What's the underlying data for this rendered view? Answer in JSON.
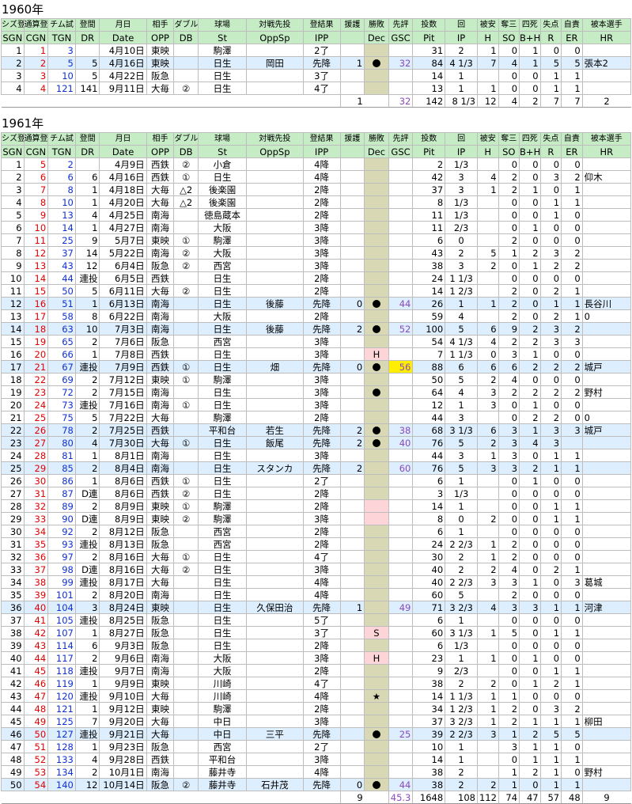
{
  "headers1": [
    "シズ登",
    "通算登",
    "チム試",
    "登間",
    "月日",
    "相手",
    "ダブル",
    "球場",
    "対戦先投",
    "登結果",
    "援護",
    "勝敗",
    "先評",
    "投数",
    "回",
    "被安",
    "奪三",
    "四死",
    "失点",
    "自責",
    "被本選手"
  ],
  "headers2": [
    "SGN",
    "CGN",
    "TGN",
    "DR",
    "Date",
    "OPP",
    "DB",
    "St",
    "OppSp",
    "IPP",
    "",
    "Dec",
    "GSC",
    "Pit",
    "IP",
    "H",
    "SO",
    "B+H",
    "R",
    "ER",
    "HR"
  ],
  "years": [
    {
      "title": "1960年",
      "rows": [
        [
          "1",
          "1",
          "3",
          "",
          "4月10日",
          "東映",
          "",
          "駒澤",
          "",
          "2了",
          "",
          "",
          "",
          "31",
          "2",
          "1",
          "0",
          "1",
          "0",
          "0",
          ""
        ],
        [
          "2",
          "2",
          "5",
          "5",
          "4月16日",
          "東映",
          "",
          "日生",
          "岡田",
          "先降",
          "1",
          "●",
          "32",
          "84",
          "4 1/3",
          "7",
          "4",
          "1",
          "5",
          "5",
          "張本2"
        ],
        [
          "3",
          "3",
          "10",
          "5",
          "4月22日",
          "阪急",
          "",
          "日生",
          "",
          "3了",
          "",
          "",
          "",
          "14",
          "1",
          "",
          "0",
          "0",
          "1",
          "1",
          ""
        ],
        [
          "4",
          "4",
          "121",
          "141",
          "9月11日",
          "大毎",
          "②",
          "日生",
          "",
          "4了",
          "",
          "",
          "",
          "13",
          "1",
          "1",
          "0",
          "0",
          "1",
          "1",
          ""
        ]
      ],
      "hl": [
        1
      ],
      "total": {
        "support": "1",
        "gsc": "32",
        "pit": "142",
        "ip": "8 1/3",
        "h": "12",
        "so": "4",
        "bh": "2",
        "r": "7",
        "er": "7",
        "hr": "2"
      }
    },
    {
      "title": "1961年",
      "rows": [
        [
          "1",
          "5",
          "2",
          "",
          "4月9日",
          "西鉄",
          "②",
          "小倉",
          "",
          "4降",
          "",
          "",
          "",
          "2",
          "1/3",
          "",
          "0",
          "0",
          "0",
          "0",
          ""
        ],
        [
          "2",
          "6",
          "6",
          "6",
          "4月16日",
          "西鉄",
          "①",
          "日生",
          "",
          "4降",
          "",
          "",
          "",
          "42",
          "3",
          "4",
          "2",
          "0",
          "3",
          "2",
          "仰木"
        ],
        [
          "3",
          "7",
          "8",
          "1",
          "4月18日",
          "大毎",
          "△2",
          "後楽園",
          "",
          "2降",
          "",
          "",
          "",
          "37",
          "3",
          "1",
          "2",
          "1",
          "0",
          "1",
          ""
        ],
        [
          "4",
          "8",
          "10",
          "1",
          "4月20日",
          "大毎",
          "△2",
          "後楽園",
          "",
          "2降",
          "",
          "",
          "",
          "8",
          "1/3",
          "",
          "0",
          "0",
          "1",
          "1",
          ""
        ],
        [
          "5",
          "9",
          "13",
          "4",
          "4月25日",
          "南海",
          "",
          "徳島蔵本",
          "",
          "2降",
          "",
          "",
          "",
          "11",
          "1/3",
          "",
          "0",
          "0",
          "1",
          "0",
          ""
        ],
        [
          "6",
          "10",
          "14",
          "1",
          "4月27日",
          "南海",
          "",
          "大阪",
          "",
          "3降",
          "",
          "",
          "",
          "11",
          "2/3",
          "",
          "0",
          "1",
          "0",
          "0",
          ""
        ],
        [
          "7",
          "11",
          "25",
          "9",
          "5月7日",
          "東映",
          "①",
          "駒澤",
          "",
          "3降",
          "",
          "",
          "",
          "6",
          "0",
          "",
          "2",
          "0",
          "0",
          "0",
          ""
        ],
        [
          "8",
          "12",
          "37",
          "14",
          "5月22日",
          "南海",
          "②",
          "大阪",
          "",
          "3降",
          "",
          "",
          "",
          "43",
          "2",
          "5",
          "1",
          "2",
          "3",
          "2",
          ""
        ],
        [
          "9",
          "13",
          "43",
          "12",
          "6月4日",
          "阪急",
          "②",
          "西宮",
          "",
          "3降",
          "",
          "",
          "",
          "38",
          "3",
          "2",
          "0",
          "1",
          "2",
          "2",
          ""
        ],
        [
          "10",
          "14",
          "44",
          "連投",
          "6月5日",
          "西鉄",
          "",
          "日生",
          "",
          "2降",
          "",
          "",
          "",
          "24",
          "1 1/3",
          "",
          "0",
          "0",
          "0",
          "0",
          ""
        ],
        [
          "11",
          "15",
          "50",
          "5",
          "6月11日",
          "大毎",
          "②",
          "日生",
          "",
          "2降",
          "",
          "",
          "",
          "14",
          "1 2/3",
          "",
          "2",
          "0",
          "2",
          "1",
          ""
        ],
        [
          "12",
          "16",
          "51",
          "1",
          "6月13日",
          "南海",
          "",
          "日生",
          "後藤",
          "先降",
          "0",
          "●",
          "44",
          "26",
          "1",
          "1",
          "2",
          "0",
          "1",
          "1",
          "長谷川"
        ],
        [
          "13",
          "17",
          "58",
          "8",
          "6月22日",
          "南海",
          "",
          "大阪",
          "",
          "2降",
          "",
          "",
          "",
          "59",
          "4",
          "",
          "2",
          "0",
          "2",
          "1",
          "0"
        ],
        [
          "14",
          "18",
          "63",
          "10",
          "7月3日",
          "南海",
          "",
          "日生",
          "後藤",
          "先降",
          "2",
          "●",
          "52",
          "100",
          "5",
          "6",
          "9",
          "2",
          "3",
          "2",
          ""
        ],
        [
          "15",
          "19",
          "65",
          "2",
          "7月6日",
          "阪急",
          "",
          "西宮",
          "",
          "3降",
          "",
          "",
          "",
          "54",
          "4 1/3",
          "4",
          "2",
          "2",
          "3",
          "3",
          ""
        ],
        [
          "16",
          "20",
          "66",
          "1",
          "7月8日",
          "西鉄",
          "",
          "日生",
          "",
          "3降",
          "",
          "H",
          "",
          "7",
          "1 1/3",
          "0",
          "3",
          "1",
          "0",
          "0",
          ""
        ],
        [
          "17",
          "21",
          "67",
          "連投",
          "7月9日",
          "西鉄",
          "①",
          "日生",
          "畑",
          "先降",
          "0",
          "●",
          "56",
          "88",
          "6",
          "6",
          "6",
          "2",
          "2",
          "2",
          "城戸"
        ],
        [
          "18",
          "22",
          "69",
          "2",
          "7月12日",
          "東映",
          "①",
          "駒澤",
          "",
          "3降",
          "",
          "",
          "",
          "50",
          "5",
          "2",
          "4",
          "0",
          "0",
          "0",
          ""
        ],
        [
          "19",
          "23",
          "72",
          "2",
          "7月15日",
          "南海",
          "",
          "日生",
          "",
          "3降",
          "",
          "●",
          "",
          "64",
          "4",
          "3",
          "2",
          "2",
          "2",
          "2",
          "野村"
        ],
        [
          "20",
          "24",
          "73",
          "連投",
          "7月16日",
          "南海",
          "①",
          "日生",
          "",
          "3降",
          "",
          "",
          "",
          "12",
          "1",
          "3",
          "0",
          "1",
          "0",
          "0",
          ""
        ],
        [
          "21",
          "25",
          "75",
          "5",
          "7月22日",
          "大毎",
          "",
          "駒澤",
          "",
          "2降",
          "",
          "",
          "",
          "44",
          "3",
          "",
          "0",
          "2",
          "2",
          "0",
          "0"
        ],
        [
          "22",
          "26",
          "78",
          "2",
          "7月25日",
          "西鉄",
          "",
          "平和台",
          "若生",
          "先降",
          "2",
          "●",
          "38",
          "68",
          "3 1/3",
          "6",
          "3",
          "1",
          "3",
          "3",
          "城戸"
        ],
        [
          "23",
          "27",
          "80",
          "4",
          "7月30日",
          "大毎",
          "①",
          "日生",
          "飯尾",
          "先降",
          "2",
          "●",
          "40",
          "76",
          "5",
          "2",
          "3",
          "4",
          "3",
          "",
          ""
        ],
        [
          "24",
          "28",
          "81",
          "1",
          "8月1日",
          "南海",
          "",
          "日生",
          "",
          "3降",
          "",
          "",
          "",
          "44",
          "3",
          "1",
          "3",
          "0",
          "1",
          "1",
          ""
        ],
        [
          "25",
          "29",
          "85",
          "2",
          "8月4日",
          "南海",
          "",
          "日生",
          "スタンカ",
          "先降",
          "2",
          "",
          "60",
          "76",
          "5",
          "3",
          "3",
          "2",
          "1",
          "1",
          ""
        ],
        [
          "26",
          "30",
          "86",
          "1",
          "8月6日",
          "西鉄",
          "①",
          "日生",
          "",
          "2了",
          "",
          "",
          "",
          "6",
          "1",
          "",
          "0",
          "1",
          "0",
          "0",
          ""
        ],
        [
          "27",
          "31",
          "87",
          "D連",
          "8月6日",
          "西鉄",
          "②",
          "日生",
          "",
          "2降",
          "",
          "",
          "",
          "3",
          "1/3",
          "",
          "0",
          "0",
          "0",
          "0",
          ""
        ],
        [
          "28",
          "32",
          "89",
          "2",
          "8月9日",
          "東映",
          "①",
          "駒澤",
          "",
          "2降",
          "",
          "",
          "",
          "14",
          "1",
          "",
          "0",
          "0",
          "1",
          "1",
          ""
        ],
        [
          "29",
          "33",
          "90",
          "D連",
          "8月9日",
          "東映",
          "②",
          "駒澤",
          "",
          "3降",
          "",
          "",
          "",
          "8",
          "0",
          "2",
          "0",
          "0",
          "1",
          "1",
          ""
        ],
        [
          "30",
          "34",
          "92",
          "2",
          "8月12日",
          "阪急",
          "",
          "西宮",
          "",
          "2降",
          "",
          "",
          "",
          "6",
          "1",
          "",
          "0",
          "0",
          "0",
          "0",
          ""
        ],
        [
          "31",
          "35",
          "93",
          "連投",
          "8月13日",
          "阪急",
          "",
          "西宮",
          "",
          "2降",
          "",
          "",
          "",
          "24",
          "2 2/3",
          "1",
          "2",
          "0",
          "0",
          "0",
          ""
        ],
        [
          "32",
          "36",
          "97",
          "2",
          "8月16日",
          "大毎",
          "①",
          "日生",
          "",
          "4了",
          "",
          "",
          "",
          "30",
          "2",
          "1",
          "2",
          "0",
          "0",
          "0",
          ""
        ],
        [
          "33",
          "37",
          "98",
          "D連",
          "8月16日",
          "大毎",
          "②",
          "日生",
          "",
          "3降",
          "",
          "",
          "",
          "40",
          "2",
          "2",
          "4",
          "0",
          "2",
          "1",
          ""
        ],
        [
          "34",
          "38",
          "99",
          "連投",
          "8月17日",
          "大毎",
          "",
          "日生",
          "",
          "4降",
          "",
          "",
          "",
          "40",
          "2 2/3",
          "3",
          "3",
          "1",
          "0",
          "3",
          "葛城"
        ],
        [
          "35",
          "39",
          "101",
          "2",
          "8月20日",
          "南海",
          "",
          "日生",
          "",
          "4降",
          "",
          "",
          "",
          "60",
          "5",
          "",
          "2",
          "0",
          "0",
          "0",
          ""
        ],
        [
          "36",
          "40",
          "104",
          "3",
          "8月24日",
          "東映",
          "",
          "日生",
          "久保田治",
          "先降",
          "1",
          "",
          "49",
          "71",
          "3 2/3",
          "4",
          "3",
          "3",
          "1",
          "1",
          "河津"
        ],
        [
          "37",
          "41",
          "105",
          "連投",
          "8月25日",
          "阪急",
          "",
          "日生",
          "",
          "5了",
          "",
          "",
          "",
          "6",
          "1",
          "",
          "0",
          "0",
          "0",
          "0",
          ""
        ],
        [
          "38",
          "42",
          "107",
          "1",
          "8月27日",
          "阪急",
          "",
          "日生",
          "",
          "3了",
          "",
          "S",
          "",
          "60",
          "3 1/3",
          "1",
          "5",
          "0",
          "1",
          "1",
          ""
        ],
        [
          "39",
          "43",
          "114",
          "6",
          "9月3日",
          "阪急",
          "",
          "日生",
          "",
          "2降",
          "",
          "",
          "",
          "6",
          "1/3",
          "",
          "0",
          "0",
          "0",
          "0",
          ""
        ],
        [
          "40",
          "44",
          "117",
          "2",
          "9月6日",
          "南海",
          "",
          "大阪",
          "",
          "3降",
          "",
          "H",
          "",
          "23",
          "1",
          "1",
          "0",
          "1",
          "0",
          "0",
          ""
        ],
        [
          "41",
          "45",
          "118",
          "連投",
          "9月7日",
          "南海",
          "",
          "大阪",
          "",
          "2降",
          "",
          "",
          "",
          "9",
          "2/3",
          "",
          "0",
          "0",
          "1",
          "1",
          ""
        ],
        [
          "42",
          "46",
          "119",
          "1",
          "9月9日",
          "東映",
          "",
          "川崎",
          "",
          "4了",
          "",
          "",
          "",
          "38",
          "2",
          "2",
          "0",
          "1",
          "2",
          "1",
          ""
        ],
        [
          "43",
          "47",
          "120",
          "連投",
          "9月10日",
          "大毎",
          "",
          "川崎",
          "",
          "4降",
          "",
          "★",
          "",
          "14",
          "1 1/3",
          "1",
          "1",
          "0",
          "0",
          "0",
          ""
        ],
        [
          "44",
          "48",
          "121",
          "1",
          "9月12日",
          "東映",
          "",
          "駒澤",
          "",
          "2降",
          "",
          "",
          "",
          "34",
          "1 2/3",
          "1",
          "2",
          "0",
          "3",
          "2",
          ""
        ],
        [
          "45",
          "49",
          "125",
          "7",
          "9月20日",
          "大毎",
          "",
          "中日",
          "",
          "3降",
          "",
          "",
          "",
          "37",
          "3 2/3",
          "1",
          "2",
          "1",
          "1",
          "1",
          "柳田"
        ],
        [
          "46",
          "50",
          "127",
          "連投",
          "9月21日",
          "大毎",
          "",
          "中日",
          "三平",
          "先降",
          "",
          "●",
          "25",
          "39",
          "2 2/3",
          "3",
          "1",
          "2",
          "5",
          "5",
          ""
        ],
        [
          "47",
          "51",
          "128",
          "1",
          "9月23日",
          "阪急",
          "",
          "西宮",
          "",
          "2了",
          "",
          "",
          "",
          "10",
          "1",
          "",
          "3",
          "1",
          "1",
          "0",
          ""
        ],
        [
          "48",
          "52",
          "133",
          "4",
          "9月28日",
          "西鉄",
          "",
          "平和台",
          "",
          "3降",
          "",
          "",
          "",
          "14",
          "1",
          "",
          "0",
          "1",
          "1",
          "1",
          ""
        ],
        [
          "49",
          "53",
          "134",
          "2",
          "10月1日",
          "南海",
          "",
          "藤井寺",
          "",
          "4降",
          "",
          "",
          "",
          "38",
          "2",
          "",
          "1",
          "2",
          "1",
          "0",
          "野村"
        ],
        [
          "50",
          "54",
          "140",
          "12",
          "10月14日",
          "阪急",
          "②",
          "藤井寺",
          "石井茂",
          "先降",
          "0",
          "●",
          "44",
          "38",
          "2",
          "2",
          "1",
          "0",
          "1",
          "1",
          ""
        ]
      ],
      "hl": [
        11,
        13,
        16,
        21,
        22,
        24,
        35,
        45,
        49
      ],
      "total": {
        "support": "9",
        "gsc": "45.3",
        "pit": "1648",
        "ip": "108",
        "h": "112",
        "so": "74",
        "bh": "47",
        "r": "57",
        "er": "48",
        "hr": "9"
      }
    }
  ]
}
